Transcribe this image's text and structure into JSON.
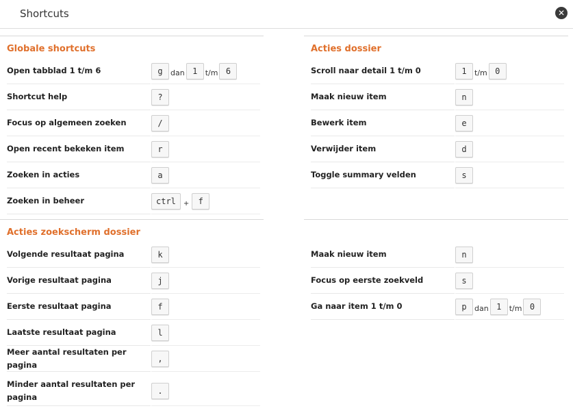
{
  "modal": {
    "title": "Shortcuts",
    "close_glyph": "✕"
  },
  "globale": {
    "heading": "Globale shortcuts",
    "rows": [
      {
        "label": "Open tabblad 1 t/m 6",
        "keys": [
          "g",
          "1",
          "6"
        ],
        "seps": [
          "dan",
          "t/m"
        ]
      },
      {
        "label": "Shortcut help",
        "keys": [
          "?"
        ]
      },
      {
        "label": "Focus op algemeen zoeken",
        "keys": [
          "/"
        ]
      },
      {
        "label": "Open recent bekeken item",
        "keys": [
          "r"
        ]
      },
      {
        "label": "Zoeken in acties",
        "keys": [
          "a"
        ]
      },
      {
        "label": "Zoeken in beheer",
        "keys": [
          "ctrl",
          "f"
        ],
        "seps": [
          "+"
        ]
      }
    ]
  },
  "acties_dossier": {
    "heading": "Acties dossier",
    "rows": [
      {
        "label": "Scroll naar detail 1 t/m 0",
        "keys": [
          "1",
          "0"
        ],
        "seps": [
          "t/m"
        ]
      },
      {
        "label": "Maak nieuw item",
        "keys": [
          "n"
        ]
      },
      {
        "label": "Bewerk item",
        "keys": [
          "e"
        ]
      },
      {
        "label": "Verwijder item",
        "keys": [
          "d"
        ]
      },
      {
        "label": "Toggle summary velden",
        "keys": [
          "s"
        ]
      }
    ]
  },
  "zoekscherm": {
    "heading": "Acties zoekscherm dossier",
    "left_rows": [
      {
        "label": "Volgende resultaat pagina",
        "keys": [
          "k"
        ]
      },
      {
        "label": "Vorige resultaat pagina",
        "keys": [
          "j"
        ]
      },
      {
        "label": "Eerste resultaat pagina",
        "keys": [
          "f"
        ]
      },
      {
        "label": "Laatste resultaat pagina",
        "keys": [
          "l"
        ]
      },
      {
        "label": "Meer aantal resultaten per pagina",
        "keys": [
          ","
        ]
      },
      {
        "label": "Minder aantal resultaten per pagina",
        "keys": [
          "."
        ]
      }
    ],
    "right_rows": [
      {
        "label": "Maak nieuw item",
        "keys": [
          "n"
        ]
      },
      {
        "label": "Focus op eerste zoekveld",
        "keys": [
          "s"
        ]
      },
      {
        "label": "Ga naar item 1 t/m 0",
        "keys": [
          "p",
          "1",
          "0"
        ],
        "seps": [
          "dan",
          "t/m"
        ]
      }
    ]
  }
}
